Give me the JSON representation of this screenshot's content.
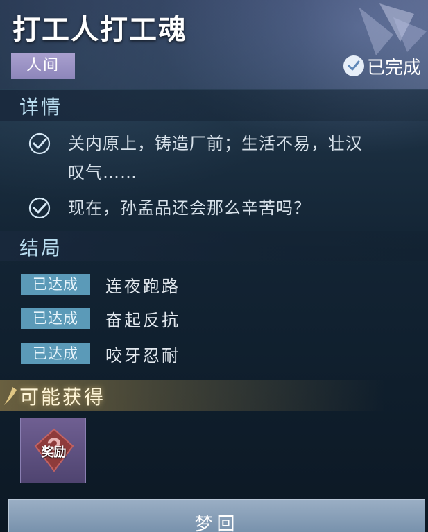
{
  "quest": {
    "title": "打工人打工魂",
    "realm_tag": "人间",
    "status": "已完成"
  },
  "details": {
    "heading": "详情",
    "items": [
      {
        "text_line1": "关内原上，铸造厂前；生活不易，壮汉",
        "text_line2": "叹气……"
      },
      {
        "text_line1": "现在，孙孟品还会那么辛苦吗？"
      }
    ]
  },
  "endings": {
    "heading": "结局",
    "items": [
      {
        "badge": "已达成",
        "label": "连夜跑路"
      },
      {
        "badge": "已达成",
        "label": "奋起反抗"
      },
      {
        "badge": "已达成",
        "label": "咬牙忍耐"
      }
    ]
  },
  "rewards": {
    "heading": "可能获得",
    "item_text": "奖励"
  },
  "action": {
    "dream_button": "梦回"
  },
  "colors": {
    "accent_check": "#d7e9f6",
    "badge_bg": "#5b9ab8",
    "realm_tag_bg": "#a9a0cf"
  }
}
